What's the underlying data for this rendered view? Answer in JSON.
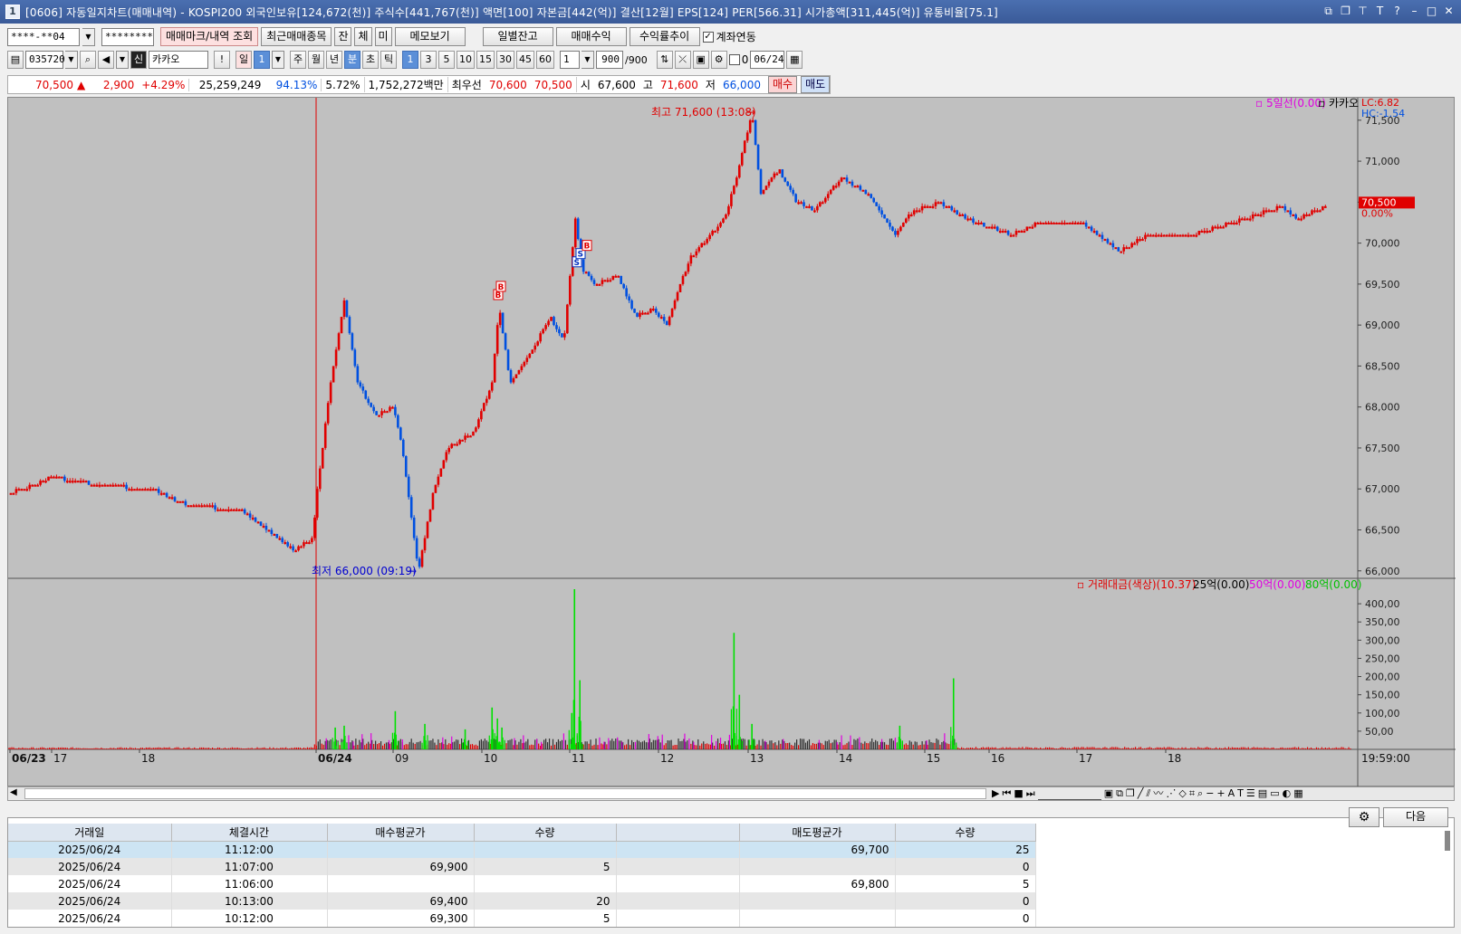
{
  "title": {
    "icon": "1",
    "text": "[0606] 자동일지차트(매매내역) - KOSPI200 외국인보유[124,672(천)] 주식수[441,767(천)] 액면[100] 자본금[442(억)] 결산[12월] EPS[124] PER[566.31] 시가총액[311,445(억)] 유통비율[75.1]"
  },
  "toolbar1": {
    "account": "****-**04",
    "password": "********",
    "btn_mark": "매매마크/내역 조회",
    "btn_recent": "최근매매종목",
    "tab_jan": "잔",
    "tab_che": "체",
    "tab_mi": "미",
    "btn_memo": "메모보기",
    "btn_daily": "일별잔고",
    "btn_profit": "매매수익",
    "btn_trend": "수익률추이",
    "chk_link_label": "계좌연동"
  },
  "toolbar2": {
    "code": "035720",
    "sin": "신",
    "name": "카카오",
    "excl": "!",
    "period_il": "일",
    "period_num": "1",
    "periods": [
      "주",
      "월",
      "년",
      "분",
      "초",
      "틱"
    ],
    "mins": [
      "1",
      "3",
      "5",
      "10",
      "15",
      "30",
      "45",
      "60"
    ],
    "count_sel": "1",
    "count_val": "900",
    "count_max": "/900",
    "zero": "0",
    "date": "06/24"
  },
  "infobar": {
    "price": "70,500",
    "arrow": "▲",
    "change": "2,900",
    "pct": "+4.29%",
    "volume": "25,259,249",
    "ratio1": "94.13%",
    "ratio2": "5.72%",
    "amount": "1,752,272백만",
    "best_label": "최우선",
    "ask": "70,600",
    "bid": "70,500",
    "open_label": "시",
    "open": "67,600",
    "high_label": "고",
    "high": "71,600",
    "low_label": "저",
    "low": "66,000",
    "buy_btn": "매수",
    "sell_btn": "매도"
  },
  "chart_data": [
    {
      "type": "candlestick",
      "title": "",
      "legend": [
        "5일선(0.00)",
        "카카오"
      ],
      "right_labels": [
        "LC:6.82",
        "HC:-1.54"
      ],
      "yticks": [
        71500,
        71000,
        70500,
        70000,
        69500,
        69000,
        68500,
        68000,
        67500,
        67000,
        66500,
        66000
      ],
      "ytick_labels": [
        "71,500",
        "71,000",
        "70,500",
        "70,000",
        "69,500",
        "69,000",
        "68,500",
        "68,000",
        "67,500",
        "67,000",
        "66,500",
        "66,000"
      ],
      "ylim": [
        65920,
        71730
      ],
      "current_price_label": "70,500",
      "current_pct_label": "0.00%",
      "annotations": [
        {
          "text": "최고 71,600 (13:08)",
          "value": 71600
        },
        {
          "text": "최저 66,000 (09:19)",
          "value": 66000
        }
      ],
      "trade_marks": [
        {
          "label": "B",
          "side": "buy",
          "value": 69300
        },
        {
          "label": "B",
          "side": "buy",
          "value": 69400
        },
        {
          "label": "S",
          "side": "sell",
          "value": 69700
        },
        {
          "label": "S",
          "side": "sell",
          "value": 69800
        },
        {
          "label": "B",
          "side": "buy",
          "value": 69900
        }
      ],
      "anchor_series": [
        {
          "i": 0,
          "v": 66950
        },
        {
          "i": 30,
          "v": 67050
        },
        {
          "i": 50,
          "v": 67150
        },
        {
          "i": 100,
          "v": 67050
        },
        {
          "i": 160,
          "v": 67000
        },
        {
          "i": 200,
          "v": 66800
        },
        {
          "i": 260,
          "v": 66750
        },
        {
          "i": 290,
          "v": 66500
        },
        {
          "i": 318,
          "v": 66250
        },
        {
          "i": 340,
          "v": 66400
        },
        {
          "i": 345,
          "v": 67000
        },
        {
          "i": 360,
          "v": 68300
        },
        {
          "i": 375,
          "v": 69300
        },
        {
          "i": 390,
          "v": 68300
        },
        {
          "i": 410,
          "v": 67900
        },
        {
          "i": 430,
          "v": 68000
        },
        {
          "i": 440,
          "v": 67500
        },
        {
          "i": 458,
          "v": 66000
        },
        {
          "i": 475,
          "v": 67000
        },
        {
          "i": 490,
          "v": 67500
        },
        {
          "i": 520,
          "v": 67700
        },
        {
          "i": 540,
          "v": 68300
        },
        {
          "i": 548,
          "v": 69200
        },
        {
          "i": 560,
          "v": 68300
        },
        {
          "i": 590,
          "v": 68800
        },
        {
          "i": 605,
          "v": 69100
        },
        {
          "i": 620,
          "v": 68800
        },
        {
          "i": 633,
          "v": 70300
        },
        {
          "i": 640,
          "v": 69700
        },
        {
          "i": 655,
          "v": 69500
        },
        {
          "i": 680,
          "v": 69600
        },
        {
          "i": 700,
          "v": 69100
        },
        {
          "i": 720,
          "v": 69200
        },
        {
          "i": 735,
          "v": 69000
        },
        {
          "i": 760,
          "v": 69800
        },
        {
          "i": 800,
          "v": 70300
        },
        {
          "i": 815,
          "v": 70900
        },
        {
          "i": 830,
          "v": 71600
        },
        {
          "i": 840,
          "v": 70600
        },
        {
          "i": 860,
          "v": 70900
        },
        {
          "i": 880,
          "v": 70500
        },
        {
          "i": 900,
          "v": 70400
        },
        {
          "i": 930,
          "v": 70800
        },
        {
          "i": 960,
          "v": 70600
        },
        {
          "i": 990,
          "v": 70100
        },
        {
          "i": 1010,
          "v": 70400
        },
        {
          "i": 1040,
          "v": 70500
        },
        {
          "i": 1070,
          "v": 70300
        },
        {
          "i": 1120,
          "v": 70100
        },
        {
          "i": 1150,
          "v": 70250
        },
        {
          "i": 1200,
          "v": 70250
        },
        {
          "i": 1240,
          "v": 69900
        },
        {
          "i": 1270,
          "v": 70100
        },
        {
          "i": 1320,
          "v": 70100
        },
        {
          "i": 1380,
          "v": 70300
        },
        {
          "i": 1420,
          "v": 70450
        },
        {
          "i": 1440,
          "v": 70300
        },
        {
          "i": 1470,
          "v": 70450
        }
      ]
    },
    {
      "type": "bar",
      "title": "",
      "legend": [
        "거래대금(색상)(10.37)",
        "25억(0.00)",
        "50억(0.00)",
        "80억(0.00)"
      ],
      "yticks": [
        400,
        350,
        300,
        250,
        200,
        150,
        100,
        50
      ],
      "ytick_labels": [
        "400,00",
        "350,00",
        "300,00",
        "250,00",
        "200,00",
        "150,00",
        "100,00",
        "50,00"
      ],
      "ylim": [
        0,
        440
      ],
      "spikes": [
        {
          "i": 365,
          "v": 60
        },
        {
          "i": 375,
          "v": 65
        },
        {
          "i": 432,
          "v": 105
        },
        {
          "i": 465,
          "v": 70
        },
        {
          "i": 510,
          "v": 55
        },
        {
          "i": 540,
          "v": 115
        },
        {
          "i": 546,
          "v": 85
        },
        {
          "i": 551,
          "v": 60
        },
        {
          "i": 629,
          "v": 100
        },
        {
          "i": 632,
          "v": 440
        },
        {
          "i": 638,
          "v": 190
        },
        {
          "i": 810,
          "v": 320
        },
        {
          "i": 816,
          "v": 150
        },
        {
          "i": 830,
          "v": 70
        },
        {
          "i": 995,
          "v": 65
        },
        {
          "i": 1055,
          "v": 195
        }
      ]
    }
  ],
  "xaxis": {
    "labels": [
      "06/23",
      "17",
      "18",
      "06/24",
      "09",
      "10",
      "11",
      "12",
      "13",
      "14",
      "15",
      "16",
      "17",
      "18"
    ],
    "time_label": "19:59:00"
  },
  "table": {
    "headers": [
      "거래일",
      "체결시간",
      "매수평균가",
      "수량",
      "",
      "매도평균가",
      "수량"
    ],
    "rows": [
      [
        "2025/06/24",
        "11:12:00",
        "",
        "",
        "",
        "69,700",
        "25"
      ],
      [
        "2025/06/24",
        "11:07:00",
        "69,900",
        "5",
        "",
        "",
        "0"
      ],
      [
        "2025/06/24",
        "11:06:00",
        "",
        "",
        "",
        "69,800",
        "5"
      ],
      [
        "2025/06/24",
        "10:13:00",
        "69,400",
        "20",
        "",
        "",
        "0"
      ],
      [
        "2025/06/24",
        "10:12:00",
        "69,300",
        "5",
        "",
        "",
        "0"
      ]
    ],
    "next_btn": "다음"
  },
  "colors": {
    "up": "#e00000",
    "down": "#0050e0",
    "vol_green": "#00e000",
    "vol_pink": "#e000e0",
    "vol_dark": "#303030"
  }
}
